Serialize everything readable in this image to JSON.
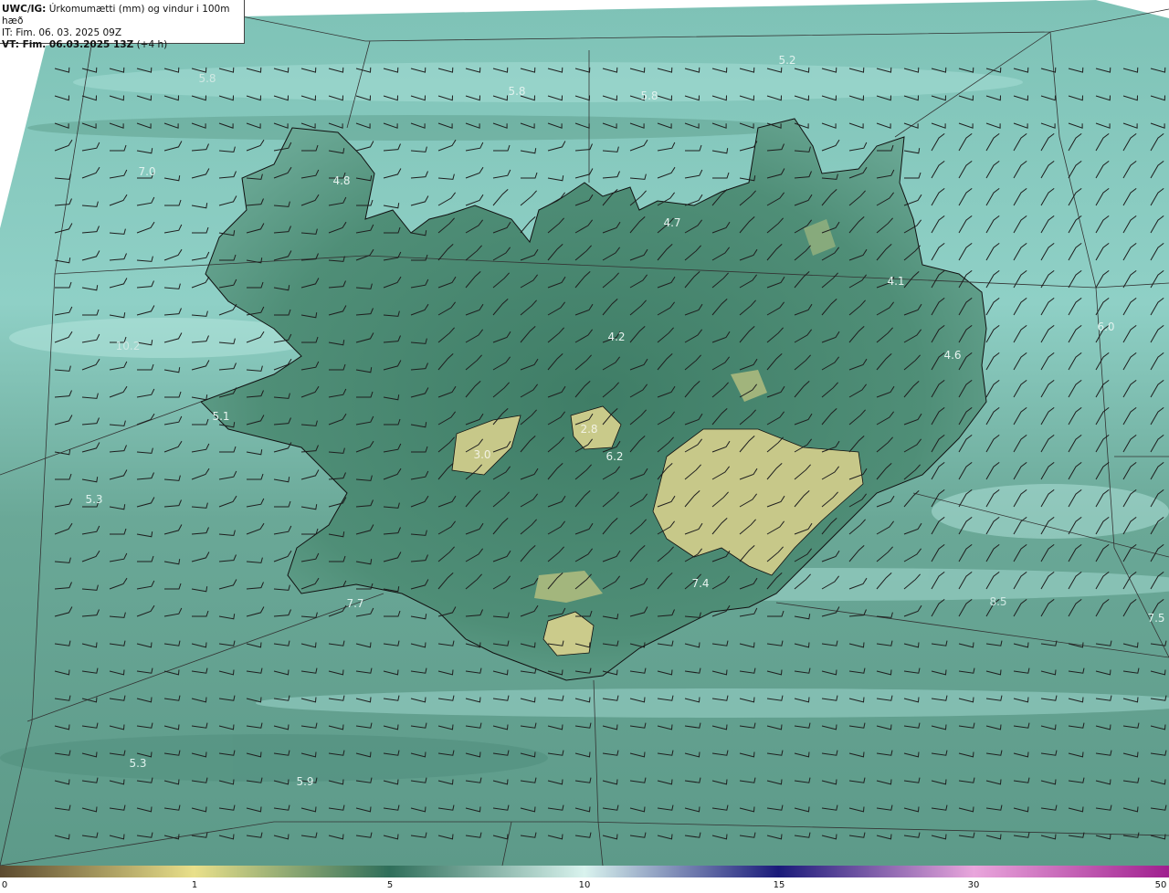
{
  "header": {
    "product": "UWC/IG:",
    "title": "Úrkomumætti (mm) og vindur i 100m hæð",
    "init_time": "IT: Fim. 06. 03. 2025 09Z",
    "valid_time_bold": "VT: Fim. 06.03.2025 13Z",
    "valid_time_offset": "(+4 h)"
  },
  "colors": {
    "ocean": "#5f9e8e",
    "ocean_light": "#9fd6cf",
    "land_dark": "#3e7a64",
    "land_mid": "#5b9a84",
    "land_dry": "#c9c885",
    "barb": "#222222",
    "coast": "#111111"
  },
  "colorbar": {
    "stops": [
      {
        "value": "0",
        "color": "#5c4a2f"
      },
      {
        "value": "1",
        "color": "#e9e08a"
      },
      {
        "value": "5",
        "color": "#2f6e5a"
      },
      {
        "value": "10",
        "color": "#d9f3ee"
      },
      {
        "value": "15",
        "color": "#1a1a7a"
      },
      {
        "value": "30",
        "color": "#e9a6dc"
      },
      {
        "value": "50",
        "color": "#a01f8f"
      }
    ],
    "labels": [
      "0",
      "1",
      "5",
      "10",
      "15",
      "30",
      "50"
    ]
  },
  "contour_labels": [
    "5.2",
    "5.8",
    "5.8",
    "5.8",
    "7.0",
    "4.8",
    "4.7",
    "4.1",
    "6.0",
    "4.6",
    "4.2",
    "2.8",
    "3.0",
    "6.2",
    "5.1",
    "5.3",
    "7.4",
    "7.7",
    "8.5",
    "7.5",
    "5.3",
    "5.9",
    "10.2"
  ],
  "map_icons": [
    "wind-barbs",
    "coastline",
    "graticule"
  ]
}
